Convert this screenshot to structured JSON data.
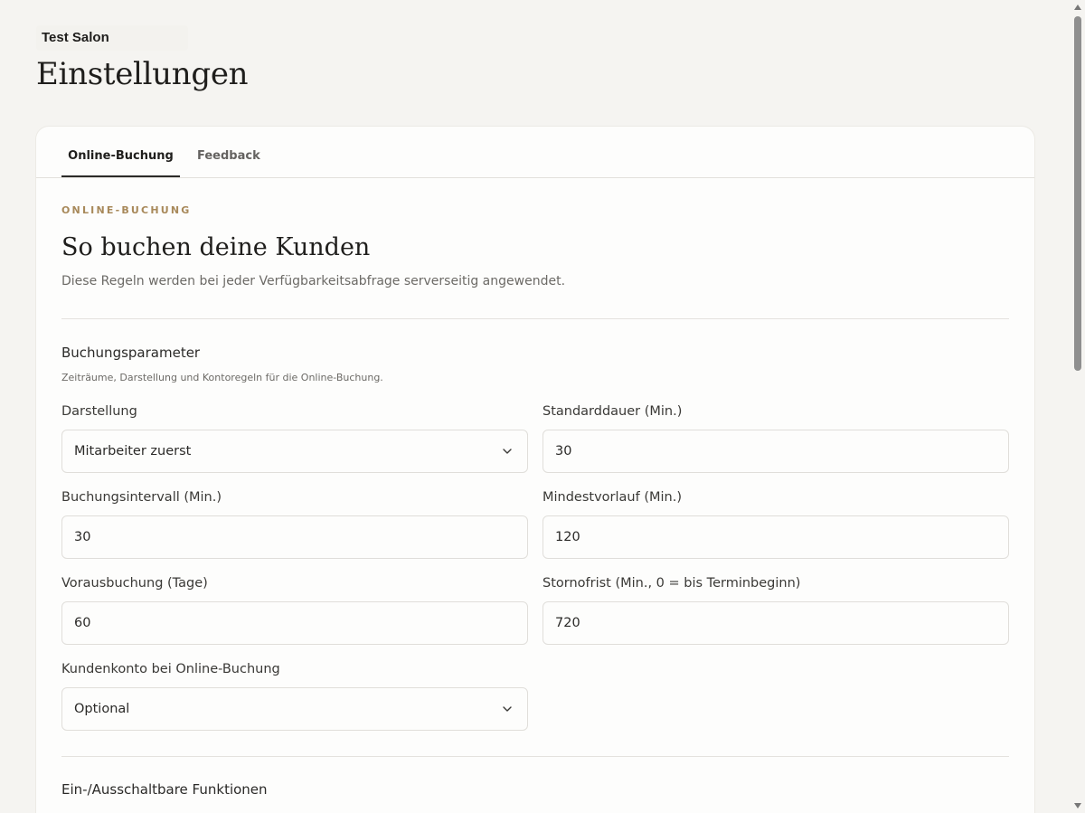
{
  "header": {
    "salon_name": "Test Salon",
    "page_title": "Einstellungen"
  },
  "tabs": [
    {
      "label": "Online-Buchung",
      "active": true
    },
    {
      "label": "Feedback",
      "active": false
    }
  ],
  "section": {
    "eyebrow": "ONLINE-BUCHUNG",
    "heading": "So buchen deine Kunden",
    "description": "Diese Regeln werden bei jeder Verfügbarkeitsabfrage serverseitig angewendet."
  },
  "booking_params": {
    "title": "Buchungsparameter",
    "description": "Zeiträume, Darstellung und Kontoregeln für die Online-Buchung.",
    "fields": {
      "darstellung": {
        "label": "Darstellung",
        "value": "Mitarbeiter zuerst"
      },
      "standarddauer": {
        "label": "Standarddauer (Min.)",
        "value": "30"
      },
      "buchungsintervall": {
        "label": "Buchungsintervall (Min.)",
        "value": "30"
      },
      "mindestvorlauf": {
        "label": "Mindestvorlauf (Min.)",
        "value": "120"
      },
      "vorausbuchung": {
        "label": "Vorausbuchung (Tage)",
        "value": "60"
      },
      "stornofrist": {
        "label": "Stornofrist (Min., 0 = bis Terminbeginn)",
        "value": "720"
      },
      "kundenkonto": {
        "label": "Kundenkonto bei Online-Buchung",
        "value": "Optional"
      }
    }
  },
  "toggles_section": {
    "title": "Ein-/Ausschaltbare Funktionen"
  },
  "colors": {
    "page_background": "#f5f4f1",
    "card_background": "#fdfdfc",
    "accent_eyebrow": "#a8895a",
    "text_primary": "#1f1e1c"
  },
  "icons": {
    "select_chevron": "chevron-down-icon"
  }
}
